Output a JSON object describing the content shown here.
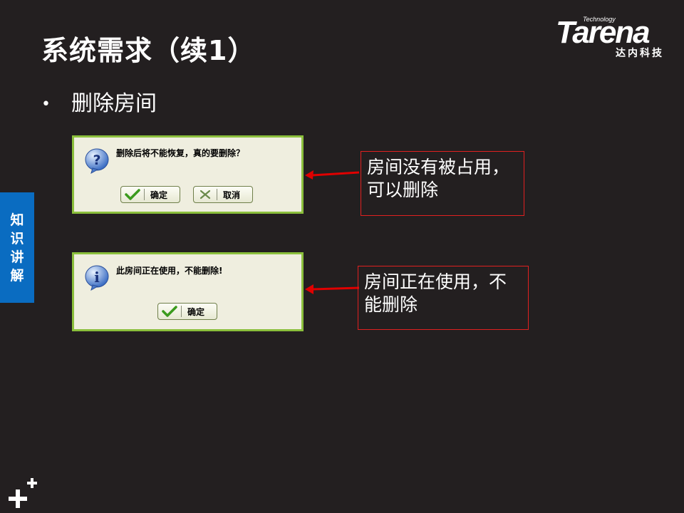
{
  "title": "系统需求（续1）",
  "logo": {
    "brand": "Tarena",
    "tagline": "Technology",
    "sub": "达内科技"
  },
  "bullet": "删除房间",
  "side_tab": [
    "知",
    "识",
    "讲",
    "解"
  ],
  "dialog1": {
    "icon": "question-icon",
    "message": "删除后将不能恢复，真的要删除？",
    "ok_label": "确定",
    "cancel_label": "取消"
  },
  "dialog2": {
    "icon": "info-icon",
    "message": "此房间正在使用，不能删除!",
    "ok_label": "确定"
  },
  "note1": {
    "line1": "房间没有被占用，",
    "line2": "可以删除"
  },
  "note2": {
    "line1": "房间正在使用，不",
    "line2": "能删除"
  },
  "colors": {
    "background": "#231f20",
    "side_tab": "#0a6cc1",
    "dialog_border": "#8bbf3c",
    "note_border": "#e02020",
    "arrow": "#e00000"
  }
}
